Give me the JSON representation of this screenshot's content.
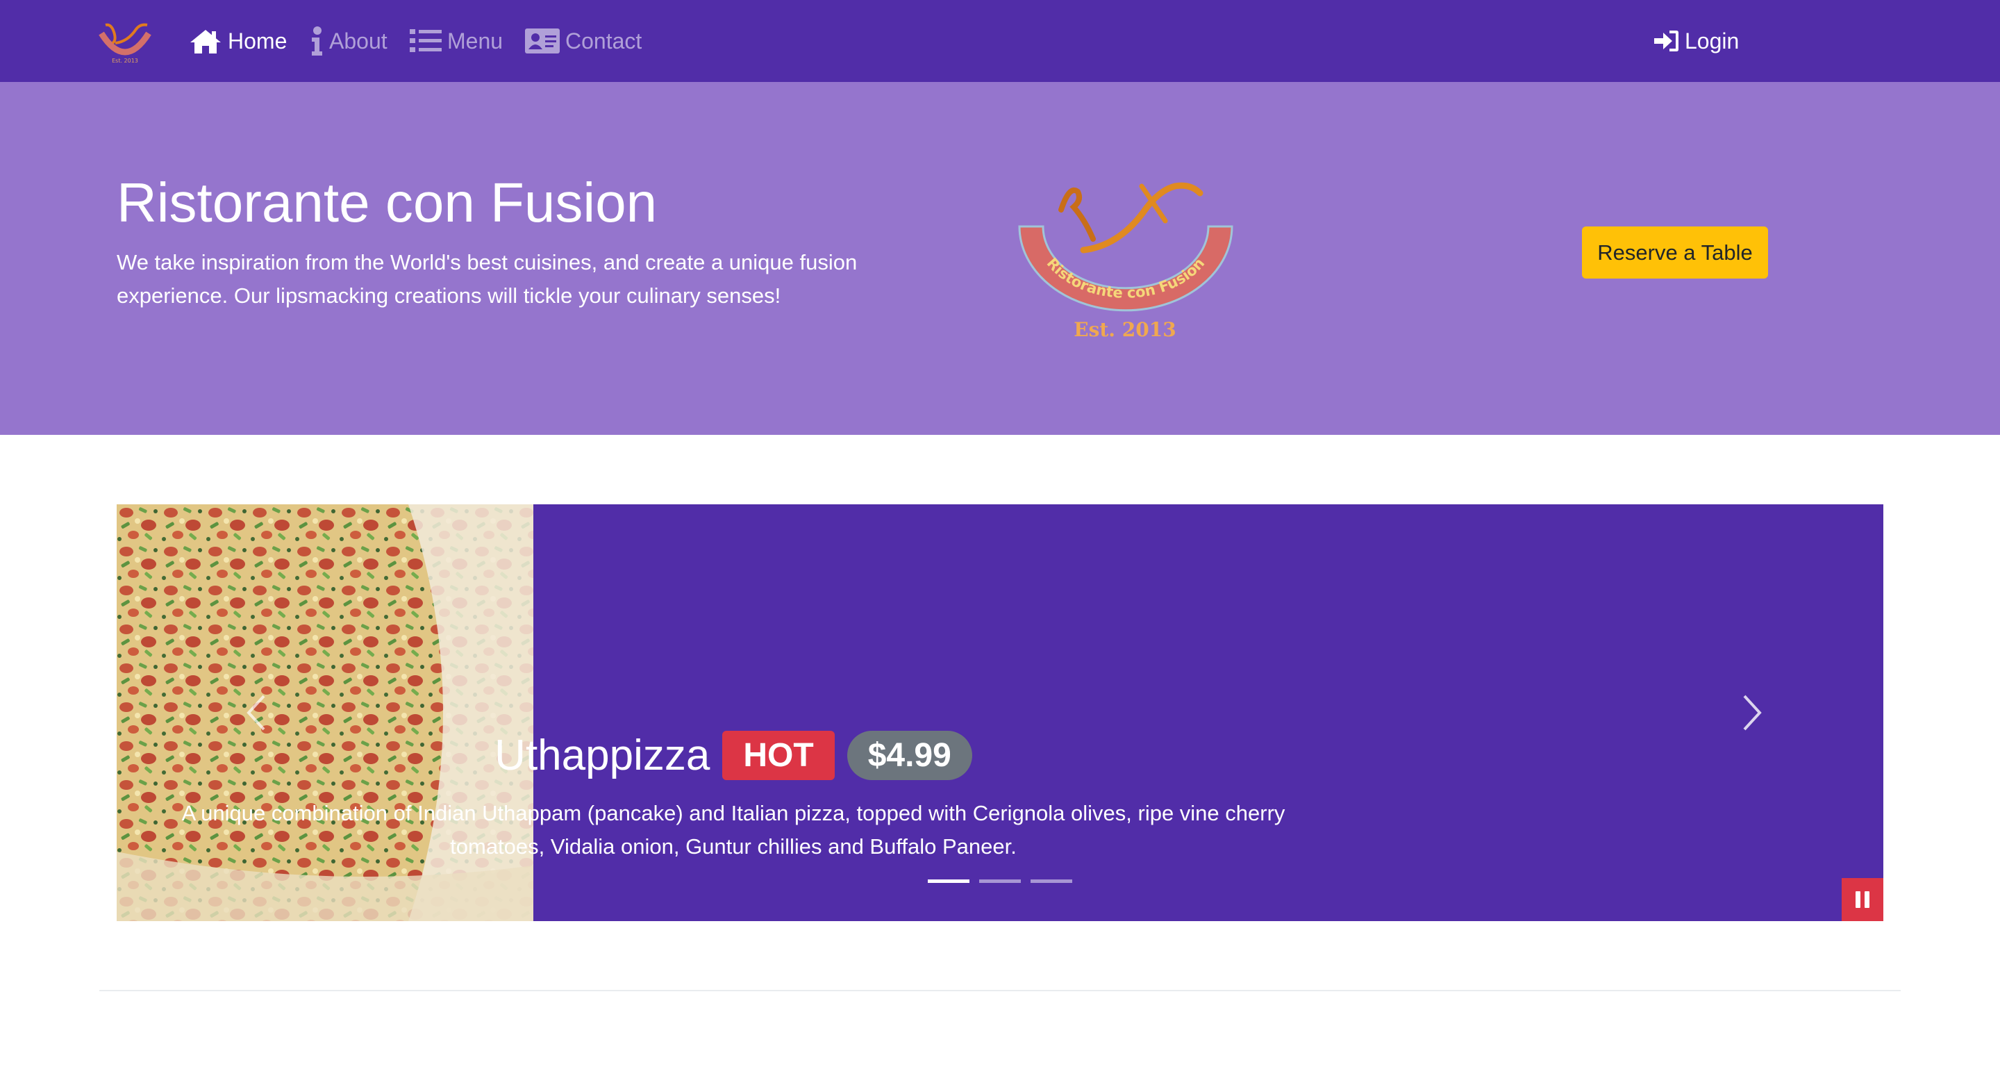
{
  "nav": {
    "brand": {
      "icon": "restaurant-logo-icon"
    },
    "items": [
      {
        "label": "Home",
        "icon": "home-icon",
        "active": true
      },
      {
        "label": "About",
        "icon": "info-icon",
        "active": false
      },
      {
        "label": "Menu",
        "icon": "list-icon",
        "active": false
      },
      {
        "label": "Contact",
        "icon": "address-card-icon",
        "active": false
      }
    ],
    "login": {
      "label": "Login",
      "icon": "sign-in-icon"
    }
  },
  "jumbotron": {
    "title": "Ristorante con Fusion",
    "description": "We take inspiration from the World's best cuisines, and create a unique fusion experience. Our lipsmacking creations will tickle your culinary senses!",
    "logo": {
      "arc_text": "Ristorante con Fusion",
      "est": "Est. 2013"
    },
    "reserve_label": "Reserve a Table"
  },
  "carousel": {
    "slide": {
      "name": "Uthappizza",
      "label": "HOT",
      "price": "$4.99",
      "description": "A unique combination of Indian Uthappam (pancake) and Italian pizza, topped with Cerignola olives, ripe vine cherry tomatoes, Vidalia onion, Guntur chillies and Buffalo Paneer."
    },
    "indicator_count": 3,
    "active_index": 0
  },
  "colors": {
    "primary_dark": "#512da8",
    "primary_light": "#9575cd",
    "warning": "#ffc107",
    "danger": "#dc3545",
    "secondary": "#6c757d"
  }
}
